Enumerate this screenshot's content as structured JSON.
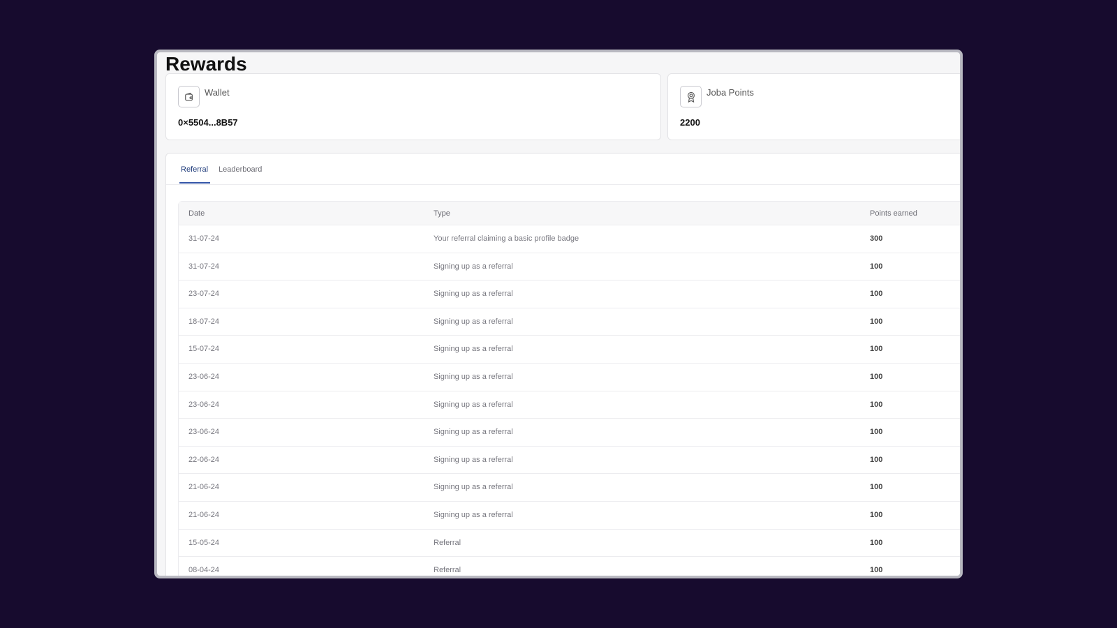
{
  "page": {
    "title": "Rewards"
  },
  "wallet_card": {
    "label": "Wallet",
    "value": "0×5504...8B57",
    "icon": "wallet-icon"
  },
  "points_card": {
    "label": "Joba Points",
    "value": "2200",
    "icon": "badge-icon"
  },
  "tabs": [
    {
      "label": "Referral",
      "active": true
    },
    {
      "label": "Leaderboard",
      "active": false
    }
  ],
  "table": {
    "headers": {
      "date": "Date",
      "type": "Type",
      "points": "Points earned"
    },
    "rows": [
      {
        "date": "31-07-24",
        "type": "Your referral claiming a basic profile badge",
        "points": "300"
      },
      {
        "date": "31-07-24",
        "type": "Signing up as a referral",
        "points": "100"
      },
      {
        "date": "23-07-24",
        "type": "Signing up as a referral",
        "points": "100"
      },
      {
        "date": "18-07-24",
        "type": "Signing up as a referral",
        "points": "100"
      },
      {
        "date": "15-07-24",
        "type": "Signing up as a referral",
        "points": "100"
      },
      {
        "date": "23-06-24",
        "type": "Signing up as a referral",
        "points": "100"
      },
      {
        "date": "23-06-24",
        "type": "Signing up as a referral",
        "points": "100"
      },
      {
        "date": "23-06-24",
        "type": "Signing up as a referral",
        "points": "100"
      },
      {
        "date": "22-06-24",
        "type": "Signing up as a referral",
        "points": "100"
      },
      {
        "date": "21-06-24",
        "type": "Signing up as a referral",
        "points": "100"
      },
      {
        "date": "21-06-24",
        "type": "Signing up as a referral",
        "points": "100"
      },
      {
        "date": "15-05-24",
        "type": "Referral",
        "points": "100"
      },
      {
        "date": "08-04-24",
        "type": "Referral",
        "points": "100"
      }
    ]
  }
}
